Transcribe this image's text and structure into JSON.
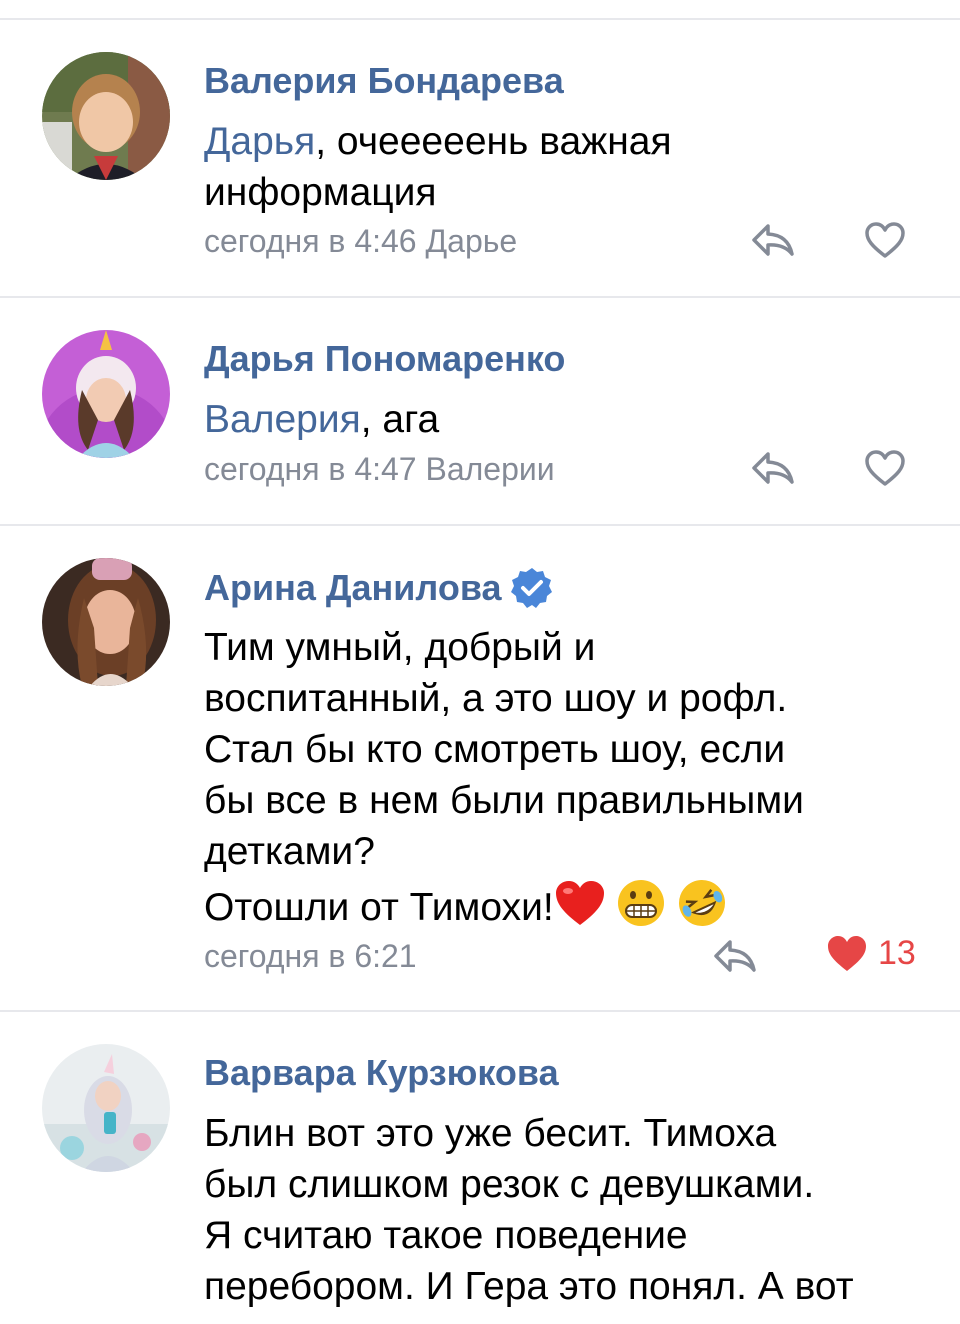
{
  "comments": [
    {
      "author": "Валерия Бондарева",
      "mention": "Дарья",
      "text": ", очееееень важная\nинформация",
      "time": "сегодня в 4:46",
      "reply_to": "Дарье",
      "likes": ""
    },
    {
      "author": "Дарья Пономаренко",
      "mention": "Валерия",
      "text": ", ага",
      "time": "сегодня в 4:47",
      "reply_to": "Валерии",
      "likes": ""
    },
    {
      "author": "Арина Данилова",
      "mention": "",
      "text": "Тим умный, добрый и\nвоспитанный, а это шоу и рофл.\nСтал бы кто смотреть шоу, если\nбы все в нем были правильными\nдетками?\nОтошли от Тимохи!",
      "time": "сегодня в 6:21",
      "reply_to": "",
      "likes": "13"
    },
    {
      "author": "Варвара Курзюкова",
      "mention": "",
      "text": "Блин вот это уже бесит. Тимоха\nбыл слишком резок с девушками.\nЯ считаю такое поведение\nперебором. И Гера это понял. А вот",
      "time": "",
      "reply_to": "",
      "likes": ""
    }
  ],
  "icons": {
    "reply": "reply-arrow-icon",
    "like": "heart-outline-icon",
    "liked": "heart-filled-icon",
    "verified": "verified-badge-icon",
    "emojis": [
      "red-heart-emoji",
      "grimacing-face-emoji",
      "rolling-laughing-emoji"
    ]
  },
  "colors": {
    "accent": "#44679a",
    "meta": "#848a96",
    "like_active": "#e64646",
    "divider": "#e7e8ec",
    "verified": "#4a86d8"
  }
}
